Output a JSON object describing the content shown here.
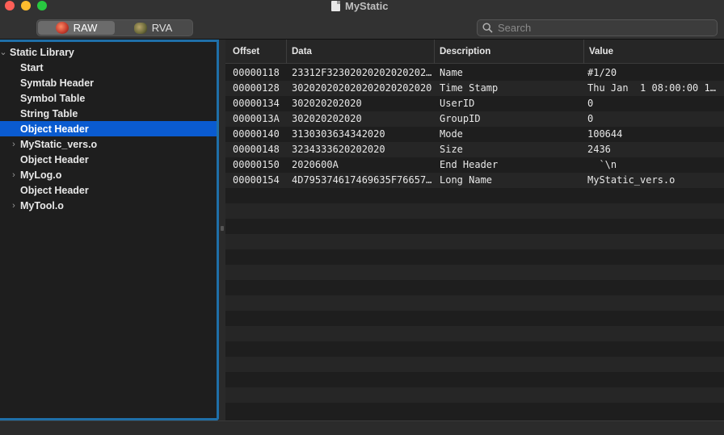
{
  "window": {
    "title": "MyStatic"
  },
  "toolbar": {
    "segments": [
      {
        "label": "RAW",
        "icon": "raw-icon",
        "active": true
      },
      {
        "label": "RVA",
        "icon": "rva-icon",
        "active": false
      }
    ],
    "search_placeholder": "Search"
  },
  "sidebar": {
    "items": [
      {
        "label": "Static Library",
        "level": 0,
        "expanded": true
      },
      {
        "label": "Start",
        "level": 1
      },
      {
        "label": "Symtab Header",
        "level": 1
      },
      {
        "label": "Symbol Table",
        "level": 1
      },
      {
        "label": "String Table",
        "level": 1
      },
      {
        "label": "Object Header",
        "level": 1,
        "selected": true
      },
      {
        "label": "MyStatic_vers.o",
        "level": 1,
        "expandable": true
      },
      {
        "label": "Object Header",
        "level": 1
      },
      {
        "label": "MyLog.o",
        "level": 1,
        "expandable": true
      },
      {
        "label": "Object Header",
        "level": 1
      },
      {
        "label": "MyTool.o",
        "level": 1,
        "expandable": true
      }
    ]
  },
  "table": {
    "columns": [
      "Offset",
      "Data",
      "Description",
      "Value"
    ],
    "rows": [
      [
        "00000118",
        "23312F32302020202020202…",
        "Name",
        "#1/20"
      ],
      [
        "00000128",
        "302020202020202020202020",
        "Time Stamp",
        "Thu Jan  1 08:00:00 1…"
      ],
      [
        "00000134",
        "302020202020",
        "UserID",
        "0"
      ],
      [
        "0000013A",
        "302020202020",
        "GroupID",
        "0"
      ],
      [
        "00000140",
        "3130303634342020",
        "Mode",
        "100644"
      ],
      [
        "00000148",
        "3234333620202020",
        "Size",
        "2436"
      ],
      [
        "00000150",
        "2020600A",
        "End Header",
        "  `\\n"
      ],
      [
        "00000154",
        "4D795374617469635F76657…",
        "Long Name",
        "MyStatic_vers.o"
      ]
    ],
    "empty_rows": 14
  },
  "colors": {
    "accent": "#0a5bd0",
    "focus_ring": "#1f6fa8"
  }
}
